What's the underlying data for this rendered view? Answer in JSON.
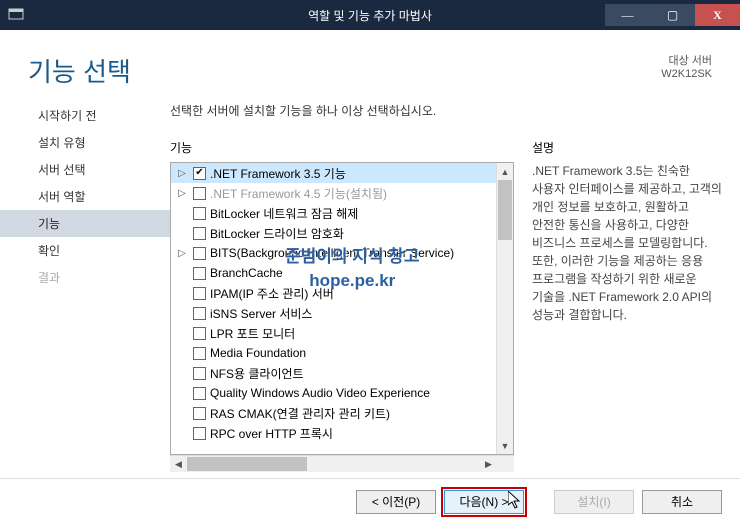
{
  "window": {
    "title": "역할 및 기능 추가 마법사",
    "min": "—",
    "max": "▢",
    "close": "X"
  },
  "header": {
    "page_title": "기능 선택",
    "target_label": "대상 서버",
    "target_value": "W2K12SK"
  },
  "sidebar": {
    "items": [
      {
        "label": "시작하기 전",
        "state": "normal"
      },
      {
        "label": "설치 유형",
        "state": "normal"
      },
      {
        "label": "서버 선택",
        "state": "normal"
      },
      {
        "label": "서버 역할",
        "state": "normal"
      },
      {
        "label": "기능",
        "state": "active"
      },
      {
        "label": "확인",
        "state": "normal"
      },
      {
        "label": "결과",
        "state": "disabled"
      }
    ]
  },
  "main": {
    "instruction": "선택한 서버에 설치할 기능을 하나 이상 선택하십시오.",
    "features_label": "기능",
    "desc_label": "설명",
    "description": ".NET Framework 3.5는 친숙한 사용자 인터페이스를 제공하고, 고객의 개인 정보를 보호하고, 원활하고 안전한 통신을 사용하고, 다양한 비즈니스 프로세스를 모델링합니다. 또한, 이러한 기능을 제공하는 응용 프로그램을 작성하기 위한 새로운 기술을 .NET Framework 2.0 API의 성능과 결합합니다.",
    "features": [
      {
        "label": ".NET Framework 3.5 기능",
        "expandable": true,
        "checked": true,
        "selected": true
      },
      {
        "label": ".NET Framework 4.5 기능(설치됨)",
        "expandable": true,
        "checked": false,
        "disabled": true
      },
      {
        "label": "BitLocker 네트워크 잠금 해제",
        "expandable": false,
        "checked": false
      },
      {
        "label": "BitLocker 드라이브 암호화",
        "expandable": false,
        "checked": false
      },
      {
        "label": "BITS(Background Intelligent Transfer Service)",
        "expandable": true,
        "checked": false
      },
      {
        "label": "BranchCache",
        "expandable": false,
        "checked": false
      },
      {
        "label": "IPAM(IP 주소 관리) 서버",
        "expandable": false,
        "checked": false
      },
      {
        "label": "iSNS Server 서비스",
        "expandable": false,
        "checked": false
      },
      {
        "label": "LPR 포트 모니터",
        "expandable": false,
        "checked": false
      },
      {
        "label": "Media Foundation",
        "expandable": false,
        "checked": false
      },
      {
        "label": "NFS용 클라이언트",
        "expandable": false,
        "checked": false
      },
      {
        "label": "Quality Windows Audio Video Experience",
        "expandable": false,
        "checked": false
      },
      {
        "label": "RAS CMAK(연결 관리자 관리 키트)",
        "expandable": false,
        "checked": false
      },
      {
        "label": "RPC over HTTP 프록시",
        "expandable": false,
        "checked": false
      }
    ]
  },
  "buttons": {
    "prev": "< 이전(P)",
    "next": "다음(N) >",
    "install": "설치(I)",
    "cancel": "취소"
  },
  "watermark": {
    "line1": "준범이의 지식 창고",
    "line2": "hope.pe.kr"
  }
}
